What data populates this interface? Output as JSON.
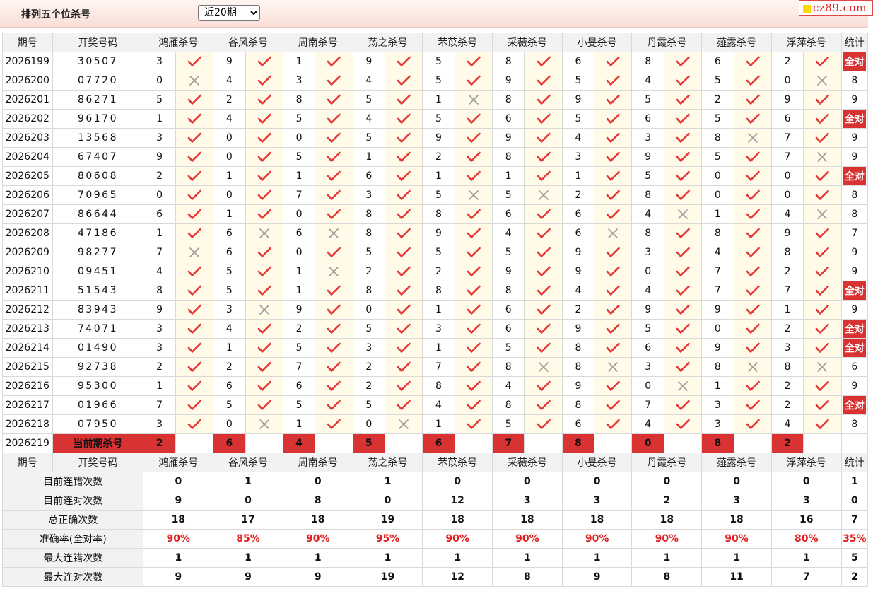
{
  "header": {
    "title": "排列五个位杀号",
    "period_selected": "近20期",
    "logo_text": "cz89.com"
  },
  "table": {
    "columns": [
      "期号",
      "开奖号码",
      "鸿雁杀号",
      "谷风杀号",
      "周南杀号",
      "荡之杀号",
      "芣苡杀号",
      "采薇杀号",
      "小旻杀号",
      "丹霞杀号",
      "薤露杀号",
      "浮萍杀号",
      "统计"
    ],
    "rows": [
      {
        "issue": "2026199",
        "draw": "30507",
        "kills": [
          "3",
          "9",
          "1",
          "9",
          "5",
          "8",
          "6",
          "8",
          "6",
          "2"
        ],
        "marks": [
          1,
          1,
          1,
          1,
          1,
          1,
          1,
          1,
          1,
          1
        ],
        "stat": "全对"
      },
      {
        "issue": "2026200",
        "draw": "07720",
        "kills": [
          "0",
          "4",
          "3",
          "4",
          "5",
          "9",
          "5",
          "4",
          "5",
          "0"
        ],
        "marks": [
          0,
          1,
          1,
          1,
          1,
          1,
          1,
          1,
          1,
          0
        ],
        "stat": "8"
      },
      {
        "issue": "2026201",
        "draw": "86271",
        "kills": [
          "5",
          "2",
          "8",
          "5",
          "1",
          "8",
          "9",
          "5",
          "2",
          "9"
        ],
        "marks": [
          1,
          1,
          1,
          1,
          0,
          1,
          1,
          1,
          1,
          1
        ],
        "stat": "9"
      },
      {
        "issue": "2026202",
        "draw": "96170",
        "kills": [
          "1",
          "4",
          "5",
          "4",
          "5",
          "6",
          "5",
          "6",
          "5",
          "6"
        ],
        "marks": [
          1,
          1,
          1,
          1,
          1,
          1,
          1,
          1,
          1,
          1
        ],
        "stat": "全对"
      },
      {
        "issue": "2026203",
        "draw": "13568",
        "kills": [
          "3",
          "0",
          "0",
          "5",
          "9",
          "9",
          "4",
          "3",
          "8",
          "7"
        ],
        "marks": [
          1,
          1,
          1,
          1,
          1,
          1,
          1,
          1,
          0,
          1
        ],
        "stat": "9"
      },
      {
        "issue": "2026204",
        "draw": "67407",
        "kills": [
          "9",
          "0",
          "5",
          "1",
          "2",
          "8",
          "3",
          "9",
          "5",
          "7"
        ],
        "marks": [
          1,
          1,
          1,
          1,
          1,
          1,
          1,
          1,
          1,
          0
        ],
        "stat": "9"
      },
      {
        "issue": "2026205",
        "draw": "80608",
        "kills": [
          "2",
          "1",
          "1",
          "6",
          "1",
          "1",
          "1",
          "5",
          "0",
          "0"
        ],
        "marks": [
          1,
          1,
          1,
          1,
          1,
          1,
          1,
          1,
          1,
          1
        ],
        "stat": "全对"
      },
      {
        "issue": "2026206",
        "draw": "70965",
        "kills": [
          "0",
          "0",
          "7",
          "3",
          "5",
          "5",
          "2",
          "8",
          "0",
          "0"
        ],
        "marks": [
          1,
          1,
          1,
          1,
          0,
          0,
          1,
          1,
          1,
          1
        ],
        "stat": "8"
      },
      {
        "issue": "2026207",
        "draw": "86644",
        "kills": [
          "6",
          "1",
          "0",
          "8",
          "8",
          "6",
          "6",
          "4",
          "1",
          "4"
        ],
        "marks": [
          1,
          1,
          1,
          1,
          1,
          1,
          1,
          0,
          1,
          0
        ],
        "stat": "8"
      },
      {
        "issue": "2026208",
        "draw": "47186",
        "kills": [
          "1",
          "6",
          "6",
          "8",
          "9",
          "4",
          "6",
          "8",
          "8",
          "9"
        ],
        "marks": [
          1,
          0,
          0,
          1,
          1,
          1,
          0,
          1,
          1,
          1
        ],
        "stat": "7"
      },
      {
        "issue": "2026209",
        "draw": "98277",
        "kills": [
          "7",
          "6",
          "0",
          "5",
          "5",
          "5",
          "9",
          "3",
          "4",
          "8"
        ],
        "marks": [
          0,
          1,
          1,
          1,
          1,
          1,
          1,
          1,
          1,
          1
        ],
        "stat": "9"
      },
      {
        "issue": "2026210",
        "draw": "09451",
        "kills": [
          "4",
          "5",
          "1",
          "2",
          "2",
          "9",
          "9",
          "0",
          "7",
          "2"
        ],
        "marks": [
          1,
          1,
          0,
          1,
          1,
          1,
          1,
          1,
          1,
          1
        ],
        "stat": "9"
      },
      {
        "issue": "2026211",
        "draw": "51543",
        "kills": [
          "8",
          "5",
          "1",
          "8",
          "8",
          "8",
          "4",
          "4",
          "7",
          "7"
        ],
        "marks": [
          1,
          1,
          1,
          1,
          1,
          1,
          1,
          1,
          1,
          1
        ],
        "stat": "全对"
      },
      {
        "issue": "2026212",
        "draw": "83943",
        "kills": [
          "9",
          "3",
          "9",
          "0",
          "1",
          "6",
          "2",
          "9",
          "9",
          "1"
        ],
        "marks": [
          1,
          0,
          1,
          1,
          1,
          1,
          1,
          1,
          1,
          1
        ],
        "stat": "9"
      },
      {
        "issue": "2026213",
        "draw": "74071",
        "kills": [
          "3",
          "4",
          "2",
          "5",
          "3",
          "6",
          "9",
          "5",
          "0",
          "2"
        ],
        "marks": [
          1,
          1,
          1,
          1,
          1,
          1,
          1,
          1,
          1,
          1
        ],
        "stat": "全对"
      },
      {
        "issue": "2026214",
        "draw": "01490",
        "kills": [
          "3",
          "1",
          "5",
          "3",
          "1",
          "5",
          "8",
          "6",
          "9",
          "3"
        ],
        "marks": [
          1,
          1,
          1,
          1,
          1,
          1,
          1,
          1,
          1,
          1
        ],
        "stat": "全对"
      },
      {
        "issue": "2026215",
        "draw": "92738",
        "kills": [
          "2",
          "2",
          "7",
          "2",
          "7",
          "8",
          "8",
          "3",
          "8",
          "8"
        ],
        "marks": [
          1,
          1,
          1,
          1,
          1,
          0,
          0,
          1,
          0,
          0
        ],
        "stat": "6"
      },
      {
        "issue": "2026216",
        "draw": "95300",
        "kills": [
          "1",
          "6",
          "6",
          "2",
          "8",
          "4",
          "9",
          "0",
          "1",
          "2"
        ],
        "marks": [
          1,
          1,
          1,
          1,
          1,
          1,
          1,
          0,
          1,
          1
        ],
        "stat": "9"
      },
      {
        "issue": "2026217",
        "draw": "01966",
        "kills": [
          "7",
          "5",
          "5",
          "5",
          "4",
          "8",
          "8",
          "7",
          "3",
          "2"
        ],
        "marks": [
          1,
          1,
          1,
          1,
          1,
          1,
          1,
          1,
          1,
          1
        ],
        "stat": "全对"
      },
      {
        "issue": "2026218",
        "draw": "07950",
        "kills": [
          "3",
          "0",
          "1",
          "0",
          "1",
          "5",
          "6",
          "4",
          "3",
          "4"
        ],
        "marks": [
          1,
          0,
          1,
          0,
          1,
          1,
          1,
          1,
          1,
          1
        ],
        "stat": "8"
      }
    ],
    "current": {
      "issue": "2026219",
      "label": "当前期杀号",
      "kills": [
        "2",
        "6",
        "4",
        "5",
        "6",
        "7",
        "8",
        "0",
        "8",
        "2"
      ]
    },
    "stats": [
      {
        "label": "目前连错次数",
        "values": [
          "0",
          "1",
          "0",
          "1",
          "0",
          "0",
          "0",
          "0",
          "0",
          "0"
        ],
        "total": "1"
      },
      {
        "label": "目前连对次数",
        "values": [
          "9",
          "0",
          "8",
          "0",
          "12",
          "3",
          "3",
          "2",
          "3",
          "3"
        ],
        "total": "0"
      },
      {
        "label": "总正确次数",
        "values": [
          "18",
          "17",
          "18",
          "19",
          "18",
          "18",
          "18",
          "18",
          "18",
          "16"
        ],
        "total": "7"
      },
      {
        "label": "准确率(全对率)",
        "values": [
          "90%",
          "85%",
          "90%",
          "95%",
          "90%",
          "90%",
          "90%",
          "90%",
          "90%",
          "80%"
        ],
        "total": "35%"
      },
      {
        "label": "最大连错次数",
        "values": [
          "1",
          "1",
          "1",
          "1",
          "1",
          "1",
          "1",
          "1",
          "1",
          "1"
        ],
        "total": "5"
      },
      {
        "label": "最大连对次数",
        "values": [
          "9",
          "9",
          "9",
          "19",
          "12",
          "8",
          "9",
          "8",
          "11",
          "7"
        ],
        "total": "2"
      }
    ],
    "stats_red_row": 3
  },
  "colors": {
    "accent_red": "#d83232",
    "check_red": "#e53535",
    "cross_gray": "#9a9a9a",
    "stat_blue": "#1530c7",
    "mark_bg": "#fffbe8"
  },
  "icons": {
    "correct": "check-icon",
    "wrong": "cross-icon"
  }
}
